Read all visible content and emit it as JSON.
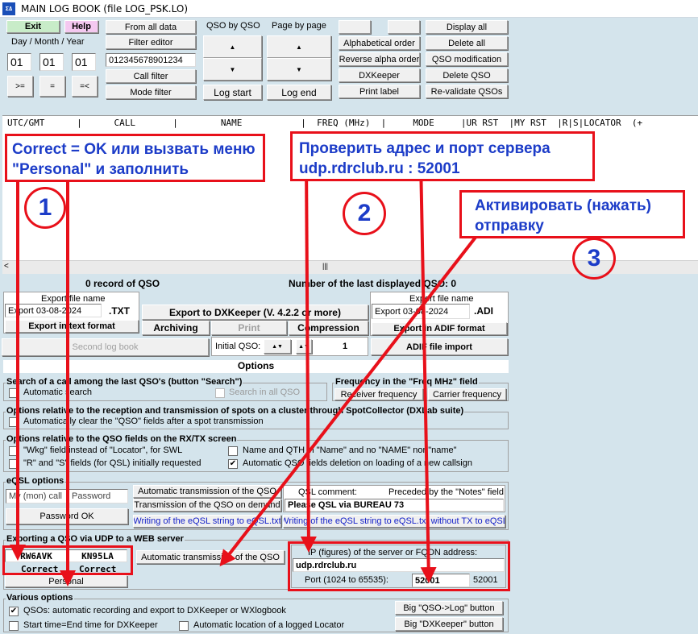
{
  "window": {
    "title": "MAIN LOG BOOK (file LOG_PSK.LO)",
    "icon_text": "ΣΔ"
  },
  "toolbar": {
    "exit": "Exit",
    "help": "Help",
    "date_label": "Day  / Month / Year",
    "day": "01",
    "month": "01",
    "year": "01",
    "ge": ">=",
    "eq": "=",
    "le": "=<",
    "from_all_data": "From all data",
    "filter_editor": "Filter editor",
    "filter_value": "012345678901234",
    "call_filter": "Call filter",
    "mode_filter": "Mode filter",
    "qso_by_qso": "QSO by QSO",
    "page_by_page": "Page by page",
    "up_arrow": "▲",
    "down_arrow": "▼",
    "log_start": "Log start",
    "log_end": "Log end",
    "alphabetical_order": "Alphabetical order",
    "reverse_alpha_order": "Reverse alpha order",
    "dxkeeper": "DXKeeper",
    "print_label": "Print label",
    "display_all": "Display all",
    "delete_all": "Delete all",
    "qso_modification": "QSO modification",
    "delete_qso": "Delete QSO",
    "revalidate_qsos": "Re-validate QSOs"
  },
  "log_header": "UTC/GMT      |      CALL       |        NAME           |  FREQ (MHz)  |     MODE     |UR RST  |MY RST  |R|S|LOCATOR  (+",
  "status": {
    "records": "0 record  of QSO",
    "last_displayed": "Number of the last displayed QSO: 0"
  },
  "export_txt": {
    "label": "Export file name",
    "filename": "Export 03-08-2024",
    "ext": ".TXT",
    "button": "Export in text format"
  },
  "export_adif": {
    "label": "Export file name",
    "filename": "Export 03-08-2024",
    "ext": ".ADI",
    "button": "Export in ADIF format",
    "import": "ADIF file import"
  },
  "middle": {
    "export_dxkeeper": "Export to DXKeeper (V. 4.2.2 or more)",
    "archiving": "Archiving",
    "print": "Print",
    "compression": "Compression",
    "initial_qso_label": "Initial QSO:",
    "initial_qso_value": "1",
    "second_log_book": "Second log book"
  },
  "options_title": "Options",
  "search_group": {
    "title": "Search of a call among the last QSO's  (button \"Search\")",
    "automatic_search": "Automatic search",
    "search_in_all": "Search in all QSO"
  },
  "freq_group": {
    "title": "Frequency in the \"Freq MHz\" field",
    "receiver": "Receiver frequency",
    "carrier": "Carrier frequency"
  },
  "spot_group": {
    "title": "Options relative to the reception and transmission of spots on a cluster through SpotCollector (DXLab suite)",
    "auto_clear": "Automatically clear the \"QSO\" fields after a spot transmission"
  },
  "rxtx_group": {
    "title": "Options relative to the QSO fields on the RX/TX screen",
    "wkg": "\"Wkg\" field instead of \"Locator\", for SWL",
    "rs": "\"R\" and \"S\" fields (for QSL) initially requested",
    "name_qth": "Name and QTH in \"Name\" and no \"NAME\" nor \"name\"",
    "auto_delete": "Automatic QSO fields deletion on loading of a new callsign",
    "check": "✔"
  },
  "eqsl_group": {
    "title": "eQSL options",
    "mycall_label": "My (mon) call",
    "password_label": "Password",
    "password_ok": "Password OK",
    "auto_transmission": "Automatic transmission of the QSO",
    "transmission_demand": "Transmission of the QSO on demand",
    "writing_string": "Writing of the eQSL string to eQSL.txt",
    "qsl_comment": "QSL comment:",
    "preceded_by": "Preceded by the \"Notes\" field",
    "qsl_comment_value": "Please QSL via BUREAU  73",
    "writing_string_notx": "Writing of the eQSL string to eQSL.txt without TX to eQSL"
  },
  "udp_group": {
    "title": "Exporting a QSO via UDP to a WEB server",
    "call": "RW6AVK",
    "locator": "KN95LA",
    "call_status": "Correct",
    "locator_status": "Correct",
    "personal": "Personal",
    "auto_transmission": "Automatic transmission of the QSO",
    "server_label": "IP (figures) of the server or FQDN address:",
    "server_value": "udp.rdrclub.ru",
    "port_label": "Port (1024 to 65535):",
    "port_value": "52001",
    "port_current": "52001"
  },
  "various_group": {
    "title": "Various options",
    "qsos_auto": "QSOs: automatic recording and export to DXKeeper or WXlogbook",
    "start_end": "Start time=End time for DXKeeper",
    "auto_locator": "Automatic location of a logged Locator",
    "big_qso_log": "Big \"QSO->Log\" button",
    "big_dxkeeper": "Big \"DXKeeper\" button"
  },
  "annotations": {
    "note1": "Correct = OK или вызвать меню \"Personal\" и заполнить",
    "note2": "Проверить адрес и порт сервера udp.rdrclub.ru : 52001",
    "note3": "Активировать (нажать) отправку",
    "num1": "1",
    "num2": "2",
    "num3": "3"
  },
  "colors": {
    "background": "#d4e4ec",
    "annotation_red": "#e8101a",
    "annotation_blue": "#1c3cc8",
    "help_pink": "#f4c8f0",
    "exit_green": "#c8ecc8"
  }
}
